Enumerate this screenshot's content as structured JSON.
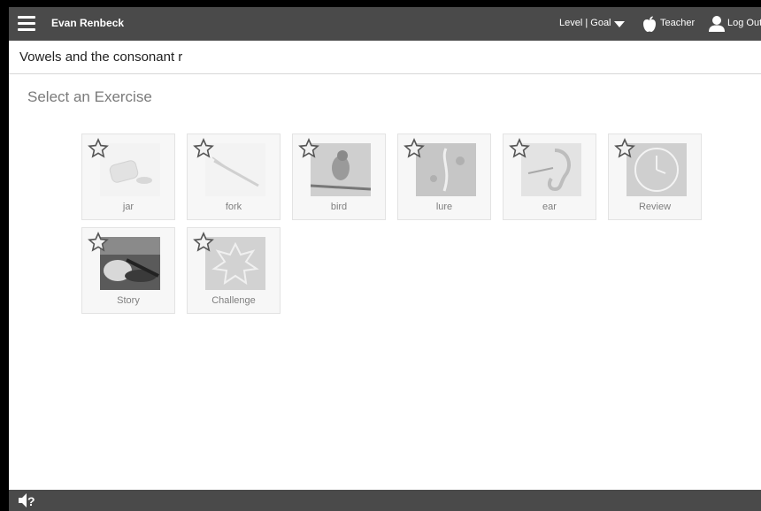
{
  "header": {
    "user_name": "Evan Renbeck",
    "level_goal": "Level | Goal",
    "teacher_label": "Teacher",
    "logout_label": "Log Out"
  },
  "lesson": {
    "title": "Vowels and the consonant r"
  },
  "main": {
    "section_title": "Select an Exercise",
    "exercises": [
      {
        "label": "jar",
        "icon": "jar-image",
        "active": false
      },
      {
        "label": "fork",
        "icon": "fork-image",
        "active": false
      },
      {
        "label": "bird",
        "icon": "bird-image",
        "active": false
      },
      {
        "label": "lure",
        "icon": "lure-image",
        "active": false
      },
      {
        "label": "ear",
        "icon": "ear-image",
        "active": false
      },
      {
        "label": "Review",
        "icon": "clock-image",
        "active": false
      },
      {
        "label": "Story",
        "icon": "story-image",
        "active": true
      },
      {
        "label": "Challenge",
        "icon": "challenge-image",
        "active": false
      }
    ]
  },
  "footer": {
    "audio_help_icon": "speaker-question-icon"
  },
  "colors": {
    "bar": "#4a4a4a",
    "tile_bg": "#f7f7f7",
    "title_gray": "#7a7a7a"
  }
}
